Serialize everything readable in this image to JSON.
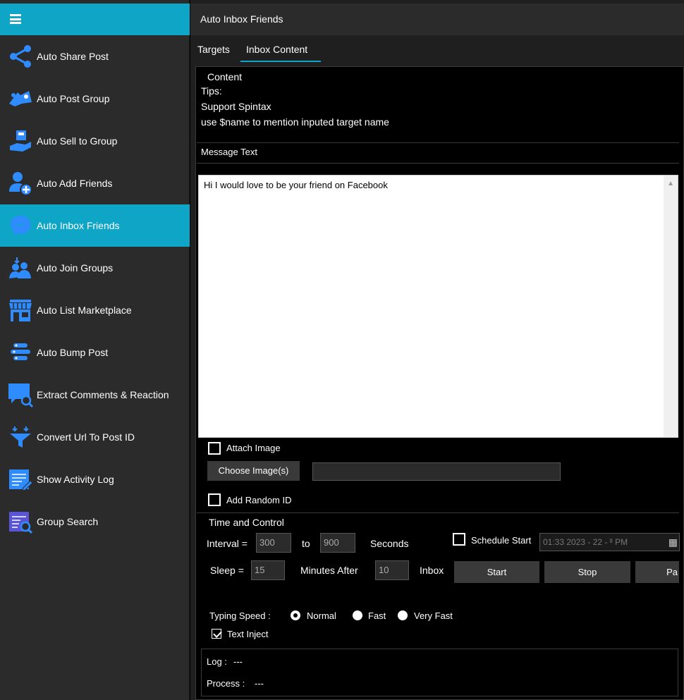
{
  "sidebar": {
    "menu_icon": "hamburger-icon",
    "items": [
      {
        "label": "Auto Share Post",
        "icon": "share-icon"
      },
      {
        "label": "Auto Post Group",
        "icon": "megaphone-icon"
      },
      {
        "label": "Auto Sell to Group",
        "icon": "sell-icon"
      },
      {
        "label": "Auto Add Friends",
        "icon": "add-user-icon"
      },
      {
        "label": "Auto Inbox Friends",
        "icon": "messenger-icon",
        "active": true
      },
      {
        "label": "Auto Join Groups",
        "icon": "group-join-icon"
      },
      {
        "label": "Auto List Marketplace",
        "icon": "store-icon"
      },
      {
        "label": "Auto Bump Post",
        "icon": "bump-icon"
      },
      {
        "label": "Extract Comments & Reaction",
        "icon": "comment-search-icon"
      },
      {
        "label": "Convert Url To Post ID",
        "icon": "funnel-icon"
      },
      {
        "label": "Show Activity Log",
        "icon": "log-icon"
      },
      {
        "label": "Group Search",
        "icon": "group-search-icon"
      }
    ]
  },
  "header": {
    "title": "Auto Inbox Friends"
  },
  "tabs": [
    {
      "label": "Targets",
      "active": false
    },
    {
      "label": "Inbox Content",
      "active": true
    }
  ],
  "content": {
    "title": "Content",
    "tips": [
      "Tips:",
      "Support Spintax",
      "use $name to mention inputed target name"
    ],
    "message_label": "Message Text",
    "message_value": "Hi I would love to be your friend on Facebook",
    "attach_image_label": "Attach Image",
    "choose_image_button": "Choose Image(s)",
    "image_path_value": "",
    "add_random_id_label": "Add Random ID"
  },
  "time_control": {
    "title": "Time and Control",
    "interval_label": "Interval =",
    "interval_from": "300",
    "to_label": "to",
    "interval_to": "900",
    "seconds_label": "Seconds",
    "schedule_label": "Schedule Start",
    "schedule_value": "01:33 2023 - 22 - ᴵᴵ PM",
    "sleep_label": "Sleep =",
    "sleep_value": "15",
    "minutes_after_label": "Minutes After",
    "minutes_after_value": "10",
    "inbox_label": "Inbox",
    "start_button": "Start",
    "stop_button": "Stop",
    "pause_button": "Pa",
    "typing_speed_label": "Typing Speed :",
    "speed_options": [
      "Normal",
      "Fast",
      "Very Fast"
    ],
    "speed_selected": "Normal",
    "text_inject_label": "Text Inject",
    "text_inject_checked": true
  },
  "log": {
    "log_label": "Log :",
    "log_value": "---",
    "process_label": "Process :",
    "process_value": "---"
  },
  "colors": {
    "accent": "#0ea5c6",
    "sidebar_bg": "#2b2b2b",
    "panel_bg": "#000000"
  }
}
